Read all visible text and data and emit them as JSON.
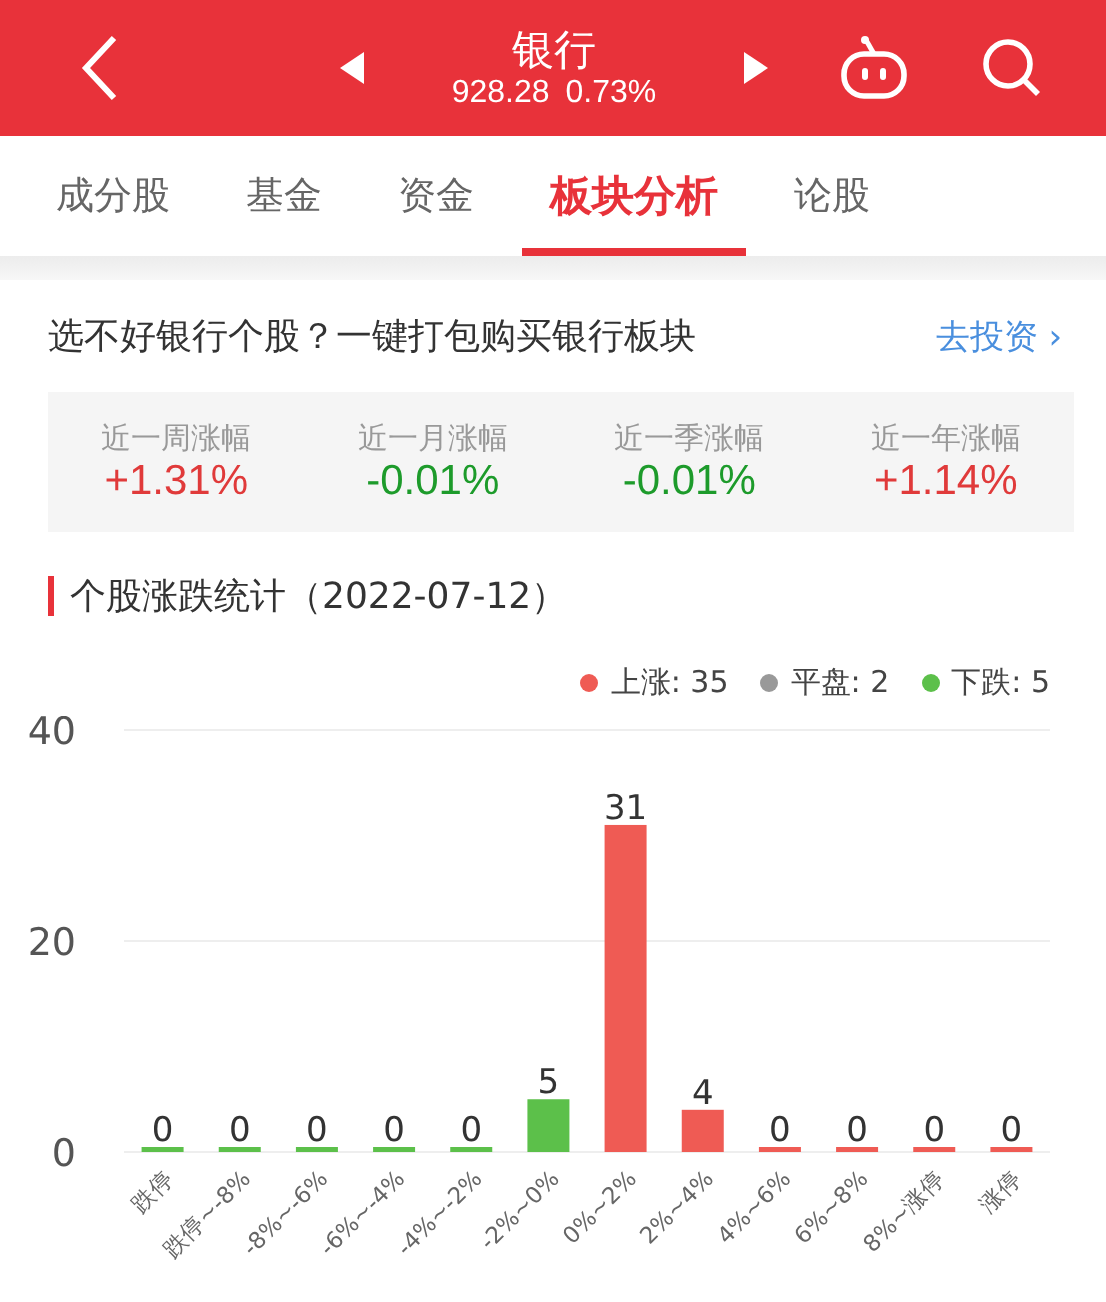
{
  "header": {
    "title": "银行",
    "price": "928.28",
    "change": "0.73%"
  },
  "tabs": [
    {
      "label": "成分股",
      "selected": false
    },
    {
      "label": "基金",
      "selected": false
    },
    {
      "label": "资金",
      "selected": false
    },
    {
      "label": "板块分析",
      "selected": true
    },
    {
      "label": "论股",
      "selected": false
    }
  ],
  "promo": {
    "text": "选不好银行个股？一键打包购买银行板块",
    "link": "去投资 ›"
  },
  "stats": [
    {
      "label": "近一周涨幅",
      "value": "+1.31%",
      "kind": "up"
    },
    {
      "label": "近一月涨幅",
      "value": "-0.01%",
      "kind": "down"
    },
    {
      "label": "近一季涨幅",
      "value": "-0.01%",
      "kind": "down"
    },
    {
      "label": "近一年涨幅",
      "value": "+1.14%",
      "kind": "up"
    }
  ],
  "section": {
    "title": "个股涨跌统计（2022-07-12）",
    "legend": [
      {
        "label": "上涨: 35",
        "color": "#ef5b54"
      },
      {
        "label": "平盘: 2",
        "color": "#999999"
      },
      {
        "label": "下跌: 5",
        "color": "#5cc04a"
      }
    ],
    "chart_data": {
      "type": "bar",
      "categories": [
        "跌停",
        "跌停~-8%",
        "-8%~-6%",
        "-6%~-4%",
        "-4%~-2%",
        "-2%~0%",
        "0%~2%",
        "2%~4%",
        "4%~6%",
        "6%~8%",
        "8%~涨停",
        "涨停"
      ],
      "series": [
        {
          "color": "#5cc04a",
          "values": [
            0,
            0,
            0,
            0,
            0,
            5,
            null,
            null,
            null,
            null,
            null,
            null
          ]
        },
        {
          "color": "#ef5b54",
          "values": [
            null,
            null,
            null,
            null,
            null,
            null,
            31,
            4,
            0,
            0,
            0,
            0
          ]
        }
      ],
      "stacked": true,
      "ylim": [
        0,
        40
      ],
      "yticks": [
        0,
        20,
        40
      ],
      "data_labels": true
    }
  }
}
